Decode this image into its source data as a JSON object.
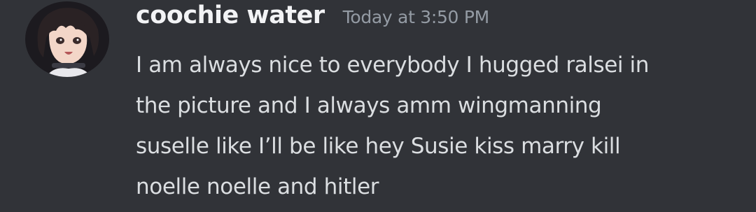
{
  "message": {
    "username": "coochie water",
    "timestamp": "Today at 3:50 PM",
    "lines": [
      "I am always nice to everybody I hugged ralsei in",
      "the picture and I always amm wingmanning",
      "suselle like I’ll be like hey Susie kiss marry kill",
      "noelle noelle and hitler"
    ]
  },
  "colors": {
    "background": "#313338",
    "username": "#f2f3f5",
    "timestamp": "#949ba4",
    "text": "#dbdee1"
  },
  "icons": {
    "avatar": "anime-character-avatar"
  }
}
